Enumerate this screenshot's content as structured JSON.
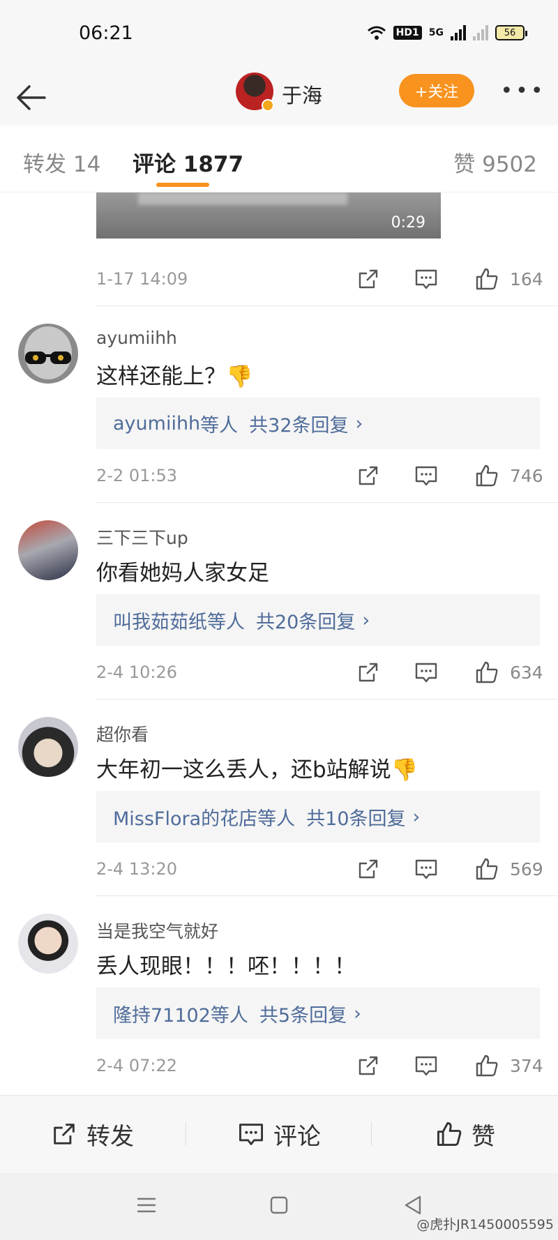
{
  "status_bar": {
    "time": "06:21",
    "network_label": "5G",
    "hd_label": "HD1",
    "battery": "56"
  },
  "header": {
    "name": "于海",
    "follow_label": "+关注",
    "more_label": "•••"
  },
  "tabs": {
    "repost": "转发 14",
    "comments": "评论 1877",
    "likes": "赞 9502"
  },
  "video": {
    "duration": "0:29"
  },
  "first_meta": {
    "time": "1-17 14:09",
    "likes": "164"
  },
  "comments": [
    {
      "username": "ayumiihh",
      "text": "这样还能上？👎",
      "reply_name": "ayumiihh",
      "reply_suffix": "等人",
      "reply_count": "共32条回复",
      "time": "2-2 01:53",
      "likes": "746"
    },
    {
      "username": "三下三下up",
      "text": "你看她妈人家女足",
      "reply_name": "叫我茹茹纸",
      "reply_suffix": "等人",
      "reply_count": "共20条回复",
      "time": "2-4 10:26",
      "likes": "634"
    },
    {
      "username": "超你看",
      "text": "大年初一这么丢人，还b站解说👎",
      "reply_name": "MissFlora的花店",
      "reply_suffix": "等人",
      "reply_count": "共10条回复",
      "time": "2-4 13:20",
      "likes": "569"
    },
    {
      "username": "当是我空气就好",
      "text": "丢人现眼！！！呸！！！！",
      "reply_name": "隆持71102",
      "reply_suffix": "等人",
      "reply_count": "共5条回复",
      "time": "2-4 07:22",
      "likes": "374"
    }
  ],
  "reply_arrow": "›",
  "action_bar": {
    "repost": "转发",
    "comment": "评论",
    "like": "赞"
  },
  "watermark": "@虎扑JR1450005595",
  "colors": {
    "accent": "#f7931e",
    "link": "#4f6c9a"
  }
}
